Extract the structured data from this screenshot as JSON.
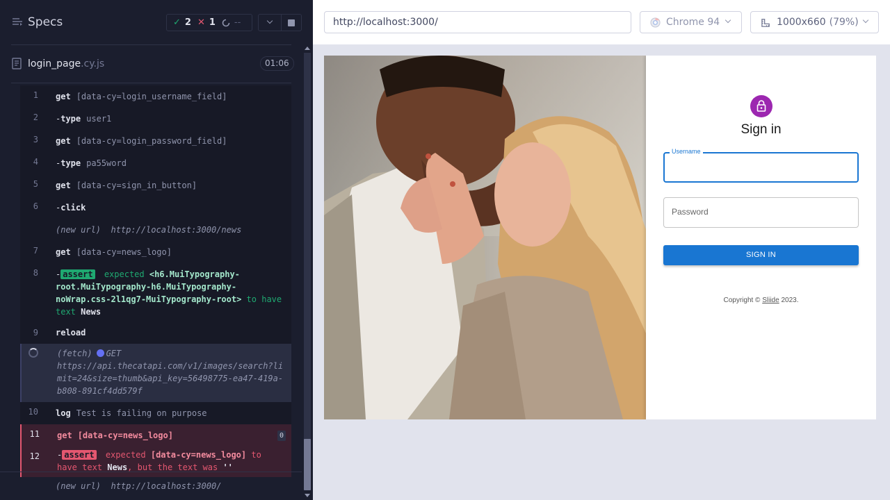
{
  "reporter": {
    "title": "Specs",
    "stats": {
      "passed": "2",
      "failed": "1",
      "pending": "--"
    },
    "file": {
      "name": "login_page",
      "ext": ".cy.js",
      "duration": "01:06"
    },
    "commands": [
      {
        "num": "1",
        "name": "get",
        "msg": "[data-cy=login_username_field]"
      },
      {
        "num": "2",
        "name": "type",
        "child": true,
        "msg": "user1"
      },
      {
        "num": "3",
        "name": "get",
        "msg": "[data-cy=login_password_field]"
      },
      {
        "num": "4",
        "name": "type",
        "child": true,
        "msg": "pa55word"
      },
      {
        "num": "5",
        "name": "get",
        "msg": "[data-cy=sign_in_button]"
      },
      {
        "num": "6",
        "name": "click",
        "child": true,
        "msg": ""
      },
      {
        "event": "(new url)",
        "msg": "http://localhost:3000/news"
      },
      {
        "num": "7",
        "name": "get",
        "msg": "[data-cy=news_logo]"
      }
    ],
    "assert_pass": {
      "num": "8",
      "badge": "assert",
      "expected": "expected",
      "subject": "<h6.MuiTypography-root.MuiTypography-h6.MuiTypography-noWrap.css-2l1qg7-MuiTypography-root>",
      "to_have": "to have text",
      "value": "News"
    },
    "reload": {
      "num": "9",
      "name": "reload"
    },
    "fetch": {
      "event": "(fetch)",
      "method": "GET",
      "url": "https://api.thecatapi.com/v1/images/search?limit=24&size=thumb&api_key=56498775-ea47-419a-b808-891cf4dd579f"
    },
    "log": {
      "num": "10",
      "name": "log",
      "msg": "Test is failing on purpose"
    },
    "fail_get": {
      "num": "11",
      "name": "get",
      "msg": "[data-cy=news_logo]",
      "count": "0"
    },
    "assert_fail": {
      "num": "12",
      "badge": "assert",
      "expected": "expected",
      "subject": "[data-cy=news_logo]",
      "to_have": "to have text",
      "value": "News",
      "but": ", but the text was",
      "actual": "''"
    },
    "last_url": {
      "event": "(new url)",
      "msg": "http://localhost:3000/"
    }
  },
  "aut": {
    "url": "http://localhost:3000/",
    "browser": "Chrome 94",
    "viewport": "1000x660",
    "zoom": "(79%)"
  },
  "app": {
    "signin_title": "Sign in",
    "username_label": "Username",
    "password_placeholder": "Password",
    "signin_button": "SIGN IN",
    "copyright_prefix": "Copyright ©",
    "copyright_link": "Sliide",
    "copyright_suffix": "2023."
  },
  "colors": {
    "pass": "#1fa971",
    "fail": "#e45770",
    "primary": "#1976d2",
    "avatar": "#9c27b0"
  }
}
